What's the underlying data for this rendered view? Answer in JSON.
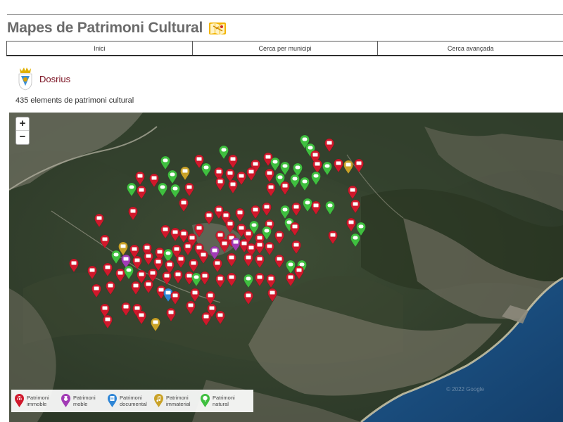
{
  "header": {
    "title": "Mapes de Patrimoni Cultural",
    "title_icon": "map-icon"
  },
  "nav": {
    "items": [
      "Inici",
      "Cerca per municipi",
      "Cerca avançada"
    ]
  },
  "municipality": {
    "name": "Dosrius",
    "crest_icon": "municipal-crest-icon"
  },
  "summary": {
    "count_text": "435 elements de patrimoni cultural"
  },
  "map": {
    "zoom_in": "+",
    "zoom_out": "−",
    "copyright": "© 2022 Google",
    "legend": [
      {
        "label": "Patrimoni\nimmoble",
        "color": "#d0182b",
        "icon": "building-icon"
      },
      {
        "label": "Patrimoni\nmoble",
        "color": "#a23bb5",
        "icon": "vase-icon"
      },
      {
        "label": "Patrimoni\ndocumental",
        "color": "#2f86d6",
        "icon": "document-icon"
      },
      {
        "label": "Patrimoni\nimmaterial",
        "color": "#c9a227",
        "icon": "music-note-icon"
      },
      {
        "label": "Patrimoni\nnatural",
        "color": "#3fbf3f",
        "icon": "tree-icon"
      }
    ]
  }
}
